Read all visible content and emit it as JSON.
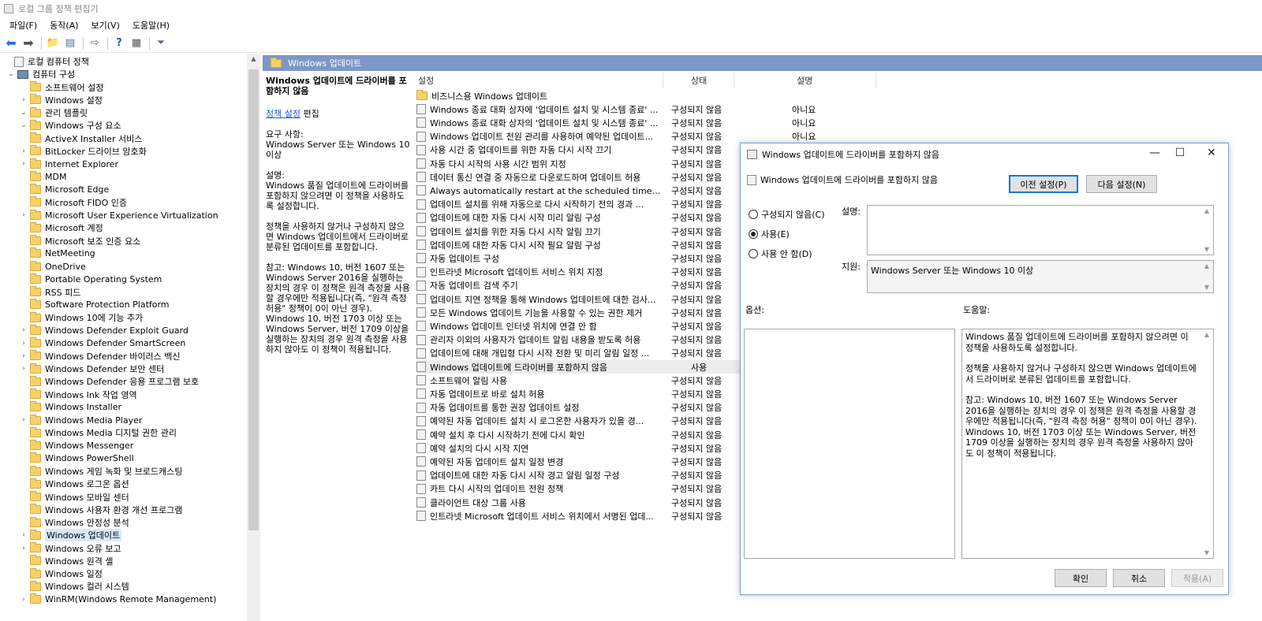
{
  "window": {
    "title": "로컬 그룹 정책 편집기"
  },
  "menu": [
    "파일(F)",
    "동작(A)",
    "보기(V)",
    "도움말(H)"
  ],
  "tree": [
    {
      "label": "로컬 컴퓨터 정책",
      "indent": 0,
      "tw": "",
      "icon": "doc"
    },
    {
      "label": "컴퓨터 구성",
      "indent": 1,
      "tw": "⌄",
      "icon": "pc"
    },
    {
      "label": "소프트웨어 설정",
      "indent": 2,
      "tw": "",
      "icon": "folder"
    },
    {
      "label": "Windows 설정",
      "indent": 2,
      "tw": "›",
      "icon": "folder"
    },
    {
      "label": "관리 템플릿",
      "indent": 2,
      "tw": "⌄",
      "icon": "folder"
    },
    {
      "label": "Windows 구성 요소",
      "indent": 3,
      "tw": "⌄",
      "icon": "folder"
    },
    {
      "label": "ActiveX Installer 서비스",
      "indent": 4,
      "tw": "",
      "icon": "folder"
    },
    {
      "label": "BitLocker 드라이브 암호화",
      "indent": 4,
      "tw": "›",
      "icon": "folder"
    },
    {
      "label": "Internet Explorer",
      "indent": 4,
      "tw": "›",
      "icon": "folder"
    },
    {
      "label": "MDM",
      "indent": 4,
      "tw": "",
      "icon": "folder"
    },
    {
      "label": "Microsoft Edge",
      "indent": 4,
      "tw": "",
      "icon": "folder"
    },
    {
      "label": "Microsoft FIDO 인증",
      "indent": 4,
      "tw": "",
      "icon": "folder"
    },
    {
      "label": "Microsoft User Experience Virtualization",
      "indent": 4,
      "tw": "›",
      "icon": "folder"
    },
    {
      "label": "Microsoft 계정",
      "indent": 4,
      "tw": "",
      "icon": "folder"
    },
    {
      "label": "Microsoft 보조 인증 요소",
      "indent": 4,
      "tw": "",
      "icon": "folder"
    },
    {
      "label": "NetMeeting",
      "indent": 4,
      "tw": "",
      "icon": "folder"
    },
    {
      "label": "OneDrive",
      "indent": 4,
      "tw": "",
      "icon": "folder"
    },
    {
      "label": "Portable Operating System",
      "indent": 4,
      "tw": "",
      "icon": "folder"
    },
    {
      "label": "RSS 피드",
      "indent": 4,
      "tw": "",
      "icon": "folder"
    },
    {
      "label": "Software Protection Platform",
      "indent": 4,
      "tw": "",
      "icon": "folder"
    },
    {
      "label": "Windows 10에 기능 추가",
      "indent": 4,
      "tw": "",
      "icon": "folder"
    },
    {
      "label": "Windows Defender Exploit Guard",
      "indent": 4,
      "tw": "›",
      "icon": "folder"
    },
    {
      "label": "Windows Defender SmartScreen",
      "indent": 4,
      "tw": "›",
      "icon": "folder"
    },
    {
      "label": "Windows Defender 바이러스 백신",
      "indent": 4,
      "tw": "›",
      "icon": "folder"
    },
    {
      "label": "Windows Defender 보안 센터",
      "indent": 4,
      "tw": "›",
      "icon": "folder"
    },
    {
      "label": "Windows Defender 응용 프로그램 보호",
      "indent": 4,
      "tw": "",
      "icon": "folder"
    },
    {
      "label": "Windows Ink 작업 영역",
      "indent": 4,
      "tw": "",
      "icon": "folder"
    },
    {
      "label": "Windows Installer",
      "indent": 4,
      "tw": "",
      "icon": "folder"
    },
    {
      "label": "Windows Media Player",
      "indent": 4,
      "tw": "›",
      "icon": "folder"
    },
    {
      "label": "Windows Media 디지털 권한 관리",
      "indent": 4,
      "tw": "",
      "icon": "folder"
    },
    {
      "label": "Windows Messenger",
      "indent": 4,
      "tw": "",
      "icon": "folder"
    },
    {
      "label": "Windows PowerShell",
      "indent": 4,
      "tw": "",
      "icon": "folder"
    },
    {
      "label": "Windows 게임 녹화 및 브로드캐스팅",
      "indent": 4,
      "tw": "",
      "icon": "folder"
    },
    {
      "label": "Windows 로그온 옵션",
      "indent": 4,
      "tw": "",
      "icon": "folder"
    },
    {
      "label": "Windows 모바일 센터",
      "indent": 4,
      "tw": "",
      "icon": "folder"
    },
    {
      "label": "Windows 사용자 환경 개선 프로그램",
      "indent": 4,
      "tw": "",
      "icon": "folder"
    },
    {
      "label": "Windows 안정성 분석",
      "indent": 4,
      "tw": "",
      "icon": "folder"
    },
    {
      "label": "Windows 업데이트",
      "indent": 4,
      "tw": "›",
      "icon": "folder",
      "selected": true
    },
    {
      "label": "Windows 오류 보고",
      "indent": 4,
      "tw": "›",
      "icon": "folder"
    },
    {
      "label": "Windows 원격 셸",
      "indent": 4,
      "tw": "",
      "icon": "folder"
    },
    {
      "label": "Windows 일정",
      "indent": 4,
      "tw": "",
      "icon": "folder"
    },
    {
      "label": "Windows 컬러 시스템",
      "indent": 4,
      "tw": "",
      "icon": "folder"
    },
    {
      "label": "WinRM(Windows Remote Management)",
      "indent": 4,
      "tw": "›",
      "icon": "folder"
    }
  ],
  "path": {
    "label": "Windows 업데이트"
  },
  "description": {
    "title": "Windows 업데이트에 드라이버를 포함하지 않음",
    "policy_link": "정책 설정",
    "edit": "편집",
    "req_label": "요구 사항:",
    "req_text": "Windows Server 또는 Windows 10 이상",
    "desc_label": "설명:",
    "desc_text1": "Windows 품질 업데이트에 드라이버를 포함하지 않으려면 이 정책을 사용하도록 설정합니다.",
    "desc_text2": " 정책을 사용하지 않거나 구성하지 않으면 Windows 업데이트에서 드라이버로 분류된 업데이트를 포함합니다.",
    "desc_text3": "참고: Windows 10, 버전 1607 또는 Windows Server 2016을 실행하는 장치의 경우 이 정책은 원격 측정을 사용할 경우에만 적용됩니다(즉, \"원격 측정 허용\" 정책이 0이 아닌 경우). Windows 10, 버전 1703 이상 또는 Windows Server, 버전 1709 이상을 실행하는 장치의 경우 원격 측정을 사용하지 않아도 이 정책이 적용됩니다."
  },
  "list": {
    "headers": {
      "setting": "설정",
      "state": "상태",
      "comment": "설명"
    },
    "rows": [
      {
        "name": "비즈니스용 Windows 업데이트",
        "state": "",
        "comment": "",
        "folder": true
      },
      {
        "name": "Windows 종료 대화 상자에 '업데이트 설치 및 시스템 종료' ...",
        "state": "구성되지 않음",
        "comment": "아니요"
      },
      {
        "name": "Windows 종료 대화 상자의 '업데이트 설치 및 시스템 종료' ...",
        "state": "구성되지 않음",
        "comment": "아니요"
      },
      {
        "name": "Windows 업데이트 전원 관리를 사용하여 예약된 업데이트...",
        "state": "구성되지 않음",
        "comment": "아니요"
      },
      {
        "name": "사용 시간 중 업데이트를 위한 자동 다시 시작 끄기",
        "state": "구성되지 않음",
        "comment": "아니요"
      },
      {
        "name": "자동 다시 시작의 사용 시간 범위 지정",
        "state": "구성되지 않음",
        "comment": "아니요"
      },
      {
        "name": "데이터 통신 연결 중 자동으로 다운로드하여 업데이트 허용",
        "state": "구성되지 않음",
        "comment": "아니요"
      },
      {
        "name": "Always automatically restart at the scheduled time(항상 예...",
        "state": "구성되지 않음",
        "comment": "아니요"
      },
      {
        "name": "업데이트 설치를 위해 자동으로 다시 시작하기 전의 경과 ...",
        "state": "구성되지 않음",
        "comment": "아니요"
      },
      {
        "name": "업데이트에 대한 자동 다시 시작 미리 알림 구성",
        "state": "구성되지 않음",
        "comment": "아니요"
      },
      {
        "name": "업데이트 설치를 위한 자동 다시 시작 알림 끄기",
        "state": "구성되지 않음",
        "comment": "아니요"
      },
      {
        "name": "업데이트에 대한 자동 다시 시작 필요 알림 구성",
        "state": "구성되지 않음",
        "comment": "아니요"
      },
      {
        "name": "자동 업데이트 구성",
        "state": "구성되지 않음",
        "comment": "아니요"
      },
      {
        "name": "인트라넷 Microsoft 업데이트 서비스 위치 지정",
        "state": "구성되지 않음",
        "comment": "아니요"
      },
      {
        "name": "자동 업데이트 검색 주기",
        "state": "구성되지 않음",
        "comment": "아니요"
      },
      {
        "name": "업데이트 지연 정책을 통해 Windows 업데이트에 대한 검사...",
        "state": "구성되지 않음",
        "comment": "아니요"
      },
      {
        "name": "모든 Windows 업데이트 기능을 사용할 수 있는 권한 제거",
        "state": "구성되지 않음",
        "comment": "아니요"
      },
      {
        "name": "Windows 업데이트 인터넷 위치에 연결 안 함",
        "state": "구성되지 않음",
        "comment": "아니요"
      },
      {
        "name": "관리자 이외의 사용자가 업데이트 알림 내용을 받도록 허용",
        "state": "구성되지 않음",
        "comment": "아니요"
      },
      {
        "name": "업데이트에 대해 개입형 다시 시작 전환 및 미리 알림 일정 ...",
        "state": "구성되지 않음",
        "comment": "아니요"
      },
      {
        "name": "Windows 업데이트에 드라이버를 포함하지 않음",
        "state": "사용",
        "comment": "아니요",
        "hl": true
      },
      {
        "name": "소프트웨어 알림 사용",
        "state": "구성되지 않음",
        "comment": "아니요"
      },
      {
        "name": "자동 업데이트로 바로 설치 허용",
        "state": "구성되지 않음",
        "comment": "아니요"
      },
      {
        "name": "자동 업데이트를 통한 권장 업데이트 설정",
        "state": "구성되지 않음",
        "comment": "아니요"
      },
      {
        "name": "예약된 자동 업데이트 설치 시 로그온한 사용자가 있을 경...",
        "state": "구성되지 않음",
        "comment": "아니요"
      },
      {
        "name": "예약 설치 후 다시 시작하기 전에 다시 확인",
        "state": "구성되지 않음",
        "comment": "아니요"
      },
      {
        "name": "예약 설치의 다시 시작 지연",
        "state": "구성되지 않음",
        "comment": "아니요"
      },
      {
        "name": "예약된 자동 업데이트 설치 일정 변경",
        "state": "구성되지 않음",
        "comment": "아니요"
      },
      {
        "name": "업데이트에 대한 자동 다시 시작 경고 알림 일정 구성",
        "state": "구성되지 않음",
        "comment": "아니요"
      },
      {
        "name": "카트 다시 시작의 업데이트 전원 정책",
        "state": "구성되지 않음",
        "comment": "아니요"
      },
      {
        "name": "클라이언트 대상 그룹 사용",
        "state": "구성되지 않음",
        "comment": "아니요"
      },
      {
        "name": "인트라넷 Microsoft 업데이트 서비스 위치에서 서명된 업데...",
        "state": "구성되지 않음",
        "comment": "아니요"
      }
    ]
  },
  "dialog": {
    "title": "Windows 업데이트에 드라이버를 포함하지 않음",
    "subtitle": "Windows 업데이트에 드라이버를 포함하지 않음",
    "prev_button": "이전 설정(P)",
    "next_button": "다음 설정(N)",
    "radio_not_configured": "구성되지 않음(C)",
    "radio_enabled": "사용(E)",
    "radio_disabled": "사용 안 함(D)",
    "comment_label": "설명:",
    "supported_label": "지원:",
    "supported_text": "Windows Server 또는 Windows 10 이상",
    "options_label": "옵션:",
    "help_label": "도움말:",
    "help_text1": "Windows 품질 업데이트에 드라이버를 포함하지 않으려면 이 정책을 사용하도록 설정합니다.",
    "help_text2": " 정책을 사용하지 않거나 구성하지 않으면 Windows 업데이트에서 드라이버로 분류된 업데이트를 포함합니다.",
    "help_text3": "참고: Windows 10, 버전 1607 또는 Windows Server 2016을 실행하는 장치의 경우 이 정책은 원격 측정을 사용할 경우에만 적용됩니다(즉, \"원격 측정 허용\" 정책이 0이 아닌 경우). Windows 10, 버전 1703 이상 또는 Windows Server, 버전 1709 이상을 실행하는 장치의 경우 원격 측정을 사용하지 않아도 이 정책이 적용됩니다.",
    "ok_button": "확인",
    "cancel_button": "취소",
    "apply_button": "적용(A)"
  }
}
